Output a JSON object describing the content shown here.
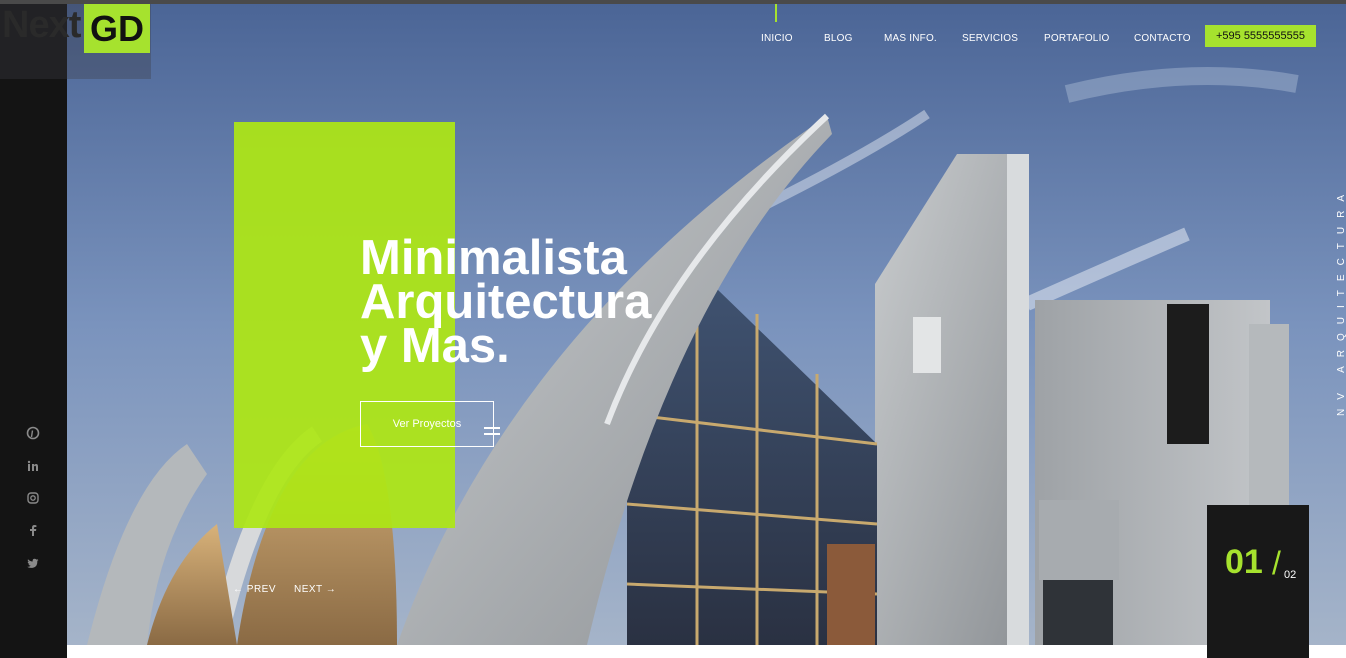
{
  "brand": {
    "logo_left": "Next",
    "logo_right": "GD"
  },
  "nav": {
    "items": [
      {
        "label": "INICIO"
      },
      {
        "label": "BLOG"
      },
      {
        "label": "MAS INFO."
      },
      {
        "label": "SERVICIOS"
      },
      {
        "label": "PORTAFOLIO"
      },
      {
        "label": "CONTACTO"
      }
    ],
    "active_index": 0,
    "phone": "+595 5555555555"
  },
  "hero": {
    "headline": [
      "Minimalista",
      "Arquitectura",
      "y Mas."
    ],
    "cta_label": "Ver Proyectos",
    "prev_label": "← PREV",
    "next_label": "NEXT →",
    "vertical_label": "NV ARQUITECTURA"
  },
  "slider": {
    "current": "01",
    "separator": "/",
    "total": "02"
  },
  "social": [
    "pinterest-icon",
    "linkedin-icon",
    "instagram-icon",
    "facebook-icon",
    "twitter-icon"
  ],
  "colors": {
    "accent": "#a6e22e",
    "dark": "#141414",
    "white": "#ffffff"
  }
}
